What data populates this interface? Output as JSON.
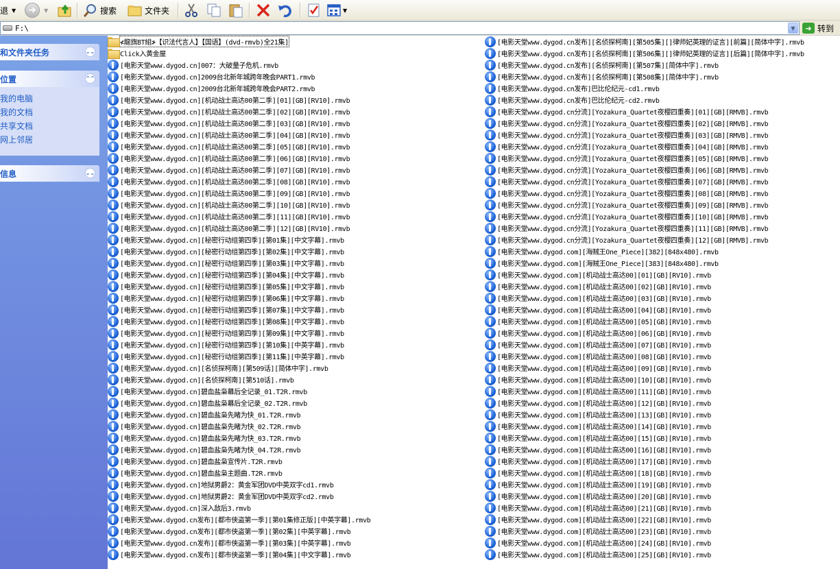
{
  "toolbar": {
    "back_label": "退",
    "search_label": "搜索",
    "folders_label": "文件夹"
  },
  "address": {
    "value": "F:\\",
    "go_label": "转到"
  },
  "sidebar": {
    "file_tasks_title": "和文件夹任务",
    "places_title": "位置",
    "places": [
      "我的电脑",
      "我的文档",
      "共享文档",
      "网上邻居"
    ],
    "details_title": "信息"
  },
  "files": {
    "left": [
      {
        "type": "folder",
        "name": "≮龍旗BT組≯【识法代言人】【国语】(dvd-rmvb)全21集]",
        "selected": true
      },
      {
        "type": "folder",
        "name": "Click入黄金屋"
      },
      {
        "type": "media",
        "name": "[电影天堂www.dygod.cn]007：大破量子危机.rmvb"
      },
      {
        "type": "media",
        "name": "[电影天堂www.dygod.cn]2009台北新年城跨年晚会PART1.rmvb"
      },
      {
        "type": "media",
        "name": "[电影天堂www.dygod.cn]2009台北新年城跨年晚会PART2.rmvb"
      },
      {
        "type": "media",
        "name": "[电影天堂www.dygod.cn][机动战士高达00第二季][01][GB][RV10].rmvb"
      },
      {
        "type": "media",
        "name": "[电影天堂www.dygod.cn][机动战士高达00第二季][02][GB][RV10].rmvb"
      },
      {
        "type": "media",
        "name": "[电影天堂www.dygod.cn][机动战士高达00第二季][03][GB][RV10].rmvb"
      },
      {
        "type": "media",
        "name": "[电影天堂www.dygod.cn][机动战士高达00第二季][04][GB][RV10].rmvb"
      },
      {
        "type": "media",
        "name": "[电影天堂www.dygod.cn][机动战士高达00第二季][05][GB][RV10].rmvb"
      },
      {
        "type": "media",
        "name": "[电影天堂www.dygod.cn][机动战士高达00第二季][06][GB][RV10].rmvb"
      },
      {
        "type": "media",
        "name": "[电影天堂www.dygod.cn][机动战士高达00第二季][07][GB][RV10].rmvb"
      },
      {
        "type": "media",
        "name": "[电影天堂www.dygod.cn][机动战士高达00第二季][08][GB][RV10].rmvb"
      },
      {
        "type": "media",
        "name": "[电影天堂www.dygod.cn][机动战士高达00第二季][09][GB][RV10].rmvb"
      },
      {
        "type": "media",
        "name": "[电影天堂www.dygod.cn][机动战士高达00第二季][10][GB][RV10].rmvb"
      },
      {
        "type": "media",
        "name": "[电影天堂www.dygod.cn][机动战士高达00第二季][11][GB][RV10].rmvb"
      },
      {
        "type": "media",
        "name": "[电影天堂www.dygod.cn][机动战士高达00第二季][12][GB][RV10].rmvb"
      },
      {
        "type": "media",
        "name": "[电影天堂www.dygod.cn][秘密行动组第四季][第01集][中文字幕].rmvb"
      },
      {
        "type": "media",
        "name": "[电影天堂www.dygod.cn][秘密行动组第四季][第02集][中文字幕].rmvb"
      },
      {
        "type": "media",
        "name": "[电影天堂www.dygod.cn][秘密行动组第四季][第03集][中文字幕].rmvb"
      },
      {
        "type": "media",
        "name": "[电影天堂www.dygod.cn][秘密行动组第四季][第04集][中文字幕].rmvb"
      },
      {
        "type": "media",
        "name": "[电影天堂www.dygod.cn][秘密行动组第四季][第05集][中文字幕].rmvb"
      },
      {
        "type": "media",
        "name": "[电影天堂www.dygod.cn][秘密行动组第四季][第06集][中文字幕].rmvb"
      },
      {
        "type": "media",
        "name": "[电影天堂www.dygod.cn][秘密行动组第四季][第07集][中文字幕].rmvb"
      },
      {
        "type": "media",
        "name": "[电影天堂www.dygod.cn][秘密行动组第四季][第08集][中文字幕].rmvb"
      },
      {
        "type": "media",
        "name": "[电影天堂www.dygod.cn][秘密行动组第四季][第09集][中文字幕].rmvb"
      },
      {
        "type": "media",
        "name": "[电影天堂www.dygod.cn][秘密行动组第四季][第10集][中英字幕].rmvb"
      },
      {
        "type": "media",
        "name": "[电影天堂www.dygod.cn][秘密行动组第四季][第11集][中英字幕].rmvb"
      },
      {
        "type": "media",
        "name": "[电影天堂www.dygod.cn][名侦探柯南][第509话][简体中字].rmvb"
      },
      {
        "type": "media",
        "name": "[电影天堂www.dygod.cn][名侦探柯南][第510话].rmvb"
      },
      {
        "type": "media",
        "name": "[电影天堂www.dygod.cn]碧血盐枭幕后全记录_01.T2R.rmvb"
      },
      {
        "type": "media",
        "name": "[电影天堂www.dygod.cn]碧血盐枭幕后全记录_02.T2R.rmvb"
      },
      {
        "type": "media",
        "name": "[电影天堂www.dygod.cn]碧血盐枭先睹为快_01.T2R.rmvb"
      },
      {
        "type": "media",
        "name": "[电影天堂www.dygod.cn]碧血盐枭先睹为快_02.T2R.rmvb"
      },
      {
        "type": "media",
        "name": "[电影天堂www.dygod.cn]碧血盐枭先睹为快_03.T2R.rmvb"
      },
      {
        "type": "media",
        "name": "[电影天堂www.dygod.cn]碧血盐枭先睹为快_04.T2R.rmvb"
      },
      {
        "type": "media",
        "name": "[电影天堂www.dygod.cn]碧血盐枭宣传片.T2R.rmvb"
      },
      {
        "type": "media",
        "name": "[电影天堂www.dygod.cn]碧血盐枭主题曲.T2R.rmvb"
      },
      {
        "type": "media",
        "name": "[电影天堂www.dygod.cn]地狱男爵2：黄金军团DVD中英双字cd1.rmvb"
      },
      {
        "type": "media",
        "name": "[电影天堂www.dygod.cn]地狱男爵2：黄金军团DVD中英双字cd2.rmvb"
      },
      {
        "type": "media",
        "name": "[电影天堂www.dygod.cn]深入敌后3.rmvb"
      },
      {
        "type": "media",
        "name": "[电影天堂www.dygod.cn发布][都市侠盗第一季][第01集修正版][中英字幕].rmvb"
      },
      {
        "type": "media",
        "name": "[电影天堂www.dygod.cn发布][都市侠盗第一季][第02集][中英字幕].rmvb"
      },
      {
        "type": "media",
        "name": "[电影天堂www.dygod.cn发布][都市侠盗第一季][第03集][中英字幕].rmvb"
      },
      {
        "type": "media",
        "name": "[电影天堂www.dygod.cn发布][都市侠盗第一季][第04集][中文字幕].rmvb"
      }
    ],
    "right": [
      {
        "type": "media",
        "name": "[电影天堂www.dygod.cn发布][名侦探柯南][第505集][]律师妃英理的证言][前篇][简体中字].rmvb"
      },
      {
        "type": "media",
        "name": "[电影天堂www.dygod.cn发布][名侦探柯南][第506集][]律师妃英理的证言][后篇][简体中字].rmvb"
      },
      {
        "type": "media",
        "name": "[电影天堂www.dygod.cn发布][名侦探柯南][第507集][简体中字].rmvb"
      },
      {
        "type": "media",
        "name": "[电影天堂www.dygod.cn发布][名侦探柯南][第508集][简体中字].rmvb"
      },
      {
        "type": "media",
        "name": "[电影天堂www.dygod.cn发布]巴比伦纪元-cd1.rmvb"
      },
      {
        "type": "media",
        "name": "[电影天堂www.dygod.cn发布]巴比伦纪元-cd2.rmvb"
      },
      {
        "type": "media",
        "name": "[电影天堂www.dygod.cn分流][Yozakura_Quartet夜樱四重奏][01][GB][RMVB].rmvb"
      },
      {
        "type": "media",
        "name": "[电影天堂www.dygod.cn分流][Yozakura_Quartet夜樱四重奏][02][GB][RMVB].rmvb"
      },
      {
        "type": "media",
        "name": "[电影天堂www.dygod.cn分流][Yozakura_Quartet夜樱四重奏][03][GB][RMVB].rmvb"
      },
      {
        "type": "media",
        "name": "[电影天堂www.dygod.cn分流][Yozakura_Quartet夜樱四重奏][04][GB][RMVB].rmvb"
      },
      {
        "type": "media",
        "name": "[电影天堂www.dygod.cn分流][Yozakura_Quartet夜樱四重奏][05][GB][RMVB].rmvb"
      },
      {
        "type": "media",
        "name": "[电影天堂www.dygod.cn分流][Yozakura_Quartet夜樱四重奏][06][GB][RMVB].rmvb"
      },
      {
        "type": "media",
        "name": "[电影天堂www.dygod.cn分流][Yozakura_Quartet夜樱四重奏][07][GB][RMVB].rmvb"
      },
      {
        "type": "media",
        "name": "[电影天堂www.dygod.cn分流][Yozakura_Quartet夜樱四重奏][08][GB][RMVB].rmvb"
      },
      {
        "type": "media",
        "name": "[电影天堂www.dygod.cn分流][Yozakura_Quartet夜樱四重奏][09][GB][RMVB].rmvb"
      },
      {
        "type": "media",
        "name": "[电影天堂www.dygod.cn分流][Yozakura_Quartet夜樱四重奏][10][GB][RMVB].rmvb"
      },
      {
        "type": "media",
        "name": "[电影天堂www.dygod.cn分流][Yozakura_Quartet夜樱四重奏][11][GB][RMVB].rmvb"
      },
      {
        "type": "media",
        "name": "[电影天堂www.dygod.cn分流][Yozakura_Quartet夜樱四重奏][12][GB][RMVB].rmvb"
      },
      {
        "type": "media",
        "name": "[电影天堂www.dygod.com][海贼王One_Piece][382][848x480].rmvb"
      },
      {
        "type": "media",
        "name": "[电影天堂www.dygod.com][海贼王One_Piece][383][848x480].rmvb"
      },
      {
        "type": "media",
        "name": "[电影天堂www.dygod.com][机动战士高达00][01][GB][RV10].rmvb"
      },
      {
        "type": "media",
        "name": "[电影天堂www.dygod.com][机动战士高达00][02][GB][RV10].rmvb"
      },
      {
        "type": "media",
        "name": "[电影天堂www.dygod.com][机动战士高达00][03][GB][RV10].rmvb"
      },
      {
        "type": "media",
        "name": "[电影天堂www.dygod.com][机动战士高达00][04][GB][RV10].rmvb"
      },
      {
        "type": "media",
        "name": "[电影天堂www.dygod.com][机动战士高达00][05][GB][RV10].rmvb"
      },
      {
        "type": "media",
        "name": "[电影天堂www.dygod.com][机动战士高达00][06][GB][RV10].rmvb"
      },
      {
        "type": "media",
        "name": "[电影天堂www.dygod.com][机动战士高达00][07][GB][RV10].rmvb"
      },
      {
        "type": "media",
        "name": "[电影天堂www.dygod.com][机动战士高达00][08][GB][RV10].rmvb"
      },
      {
        "type": "media",
        "name": "[电影天堂www.dygod.com][机动战士高达00][09][GB][RV10].rmvb"
      },
      {
        "type": "media",
        "name": "[电影天堂www.dygod.com][机动战士高达00][10][GB][RV10].rmvb"
      },
      {
        "type": "media",
        "name": "[电影天堂www.dygod.com][机动战士高达00][11][GB][RV10].rmvb"
      },
      {
        "type": "media",
        "name": "[电影天堂www.dygod.com][机动战士高达00][12][GB][RV10].rmvb"
      },
      {
        "type": "media",
        "name": "[电影天堂www.dygod.com][机动战士高达00][13][GB][RV10].rmvb"
      },
      {
        "type": "media",
        "name": "[电影天堂www.dygod.com][机动战士高达00][14][GB][RV10].rmvb"
      },
      {
        "type": "media",
        "name": "[电影天堂www.dygod.com][机动战士高达00][15][GB][RV10].rmvb"
      },
      {
        "type": "media",
        "name": "[电影天堂www.dygod.com][机动战士高达00][16][GB][RV10].rmvb"
      },
      {
        "type": "media",
        "name": "[电影天堂www.dygod.com][机动战士高达00][17][GB][RV10].rmvb"
      },
      {
        "type": "media",
        "name": "[电影天堂www.dygod.com][机动战士高达00][18][GB][RV10].rmvb"
      },
      {
        "type": "media",
        "name": "[电影天堂www.dygod.com][机动战士高达00][19][GB][RV10].rmvb"
      },
      {
        "type": "media",
        "name": "[电影天堂www.dygod.com][机动战士高达00][20][GB][RV10].rmvb"
      },
      {
        "type": "media",
        "name": "[电影天堂www.dygod.com][机动战士高达00][21][GB][RV10].rmvb"
      },
      {
        "type": "media",
        "name": "[电影天堂www.dygod.com][机动战士高达00][22][GB][RV10].rmvb"
      },
      {
        "type": "media",
        "name": "[电影天堂www.dygod.com][机动战士高达00][23][GB][RV10].rmvb"
      },
      {
        "type": "media",
        "name": "[电影天堂www.dygod.com][机动战士高达00][24][GB][RV10].rmvb"
      },
      {
        "type": "media",
        "name": "[电影天堂www.dygod.com][机动战士高达00][25][GB][RV10].rmvb"
      }
    ]
  }
}
